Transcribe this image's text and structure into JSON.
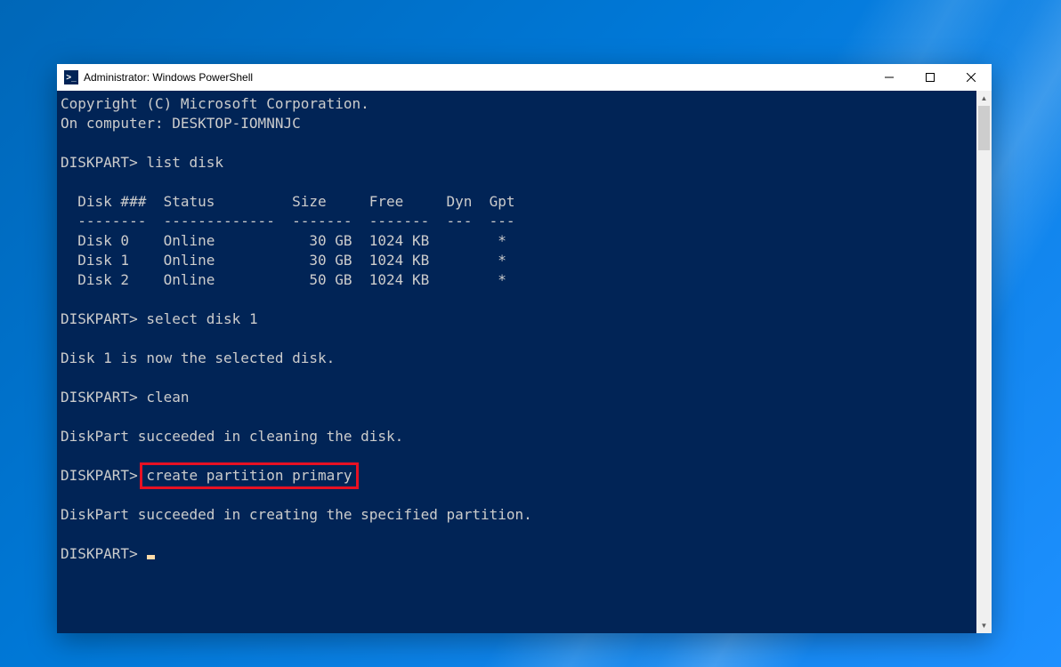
{
  "window": {
    "title": "Administrator: Windows PowerShell",
    "icon_glyph": ">_"
  },
  "terminal": {
    "copyright": "Copyright (C) Microsoft Corporation.",
    "on_computer": "On computer: DESKTOP-IOMNNJC",
    "prompt": "DISKPART>",
    "cmd_list_disk": "list disk",
    "table_header": "  Disk ###  Status         Size     Free     Dyn  Gpt",
    "table_divider": "  --------  -------------  -------  -------  ---  ---",
    "disks": [
      "  Disk 0    Online           30 GB  1024 KB        *",
      "  Disk 1    Online           30 GB  1024 KB        *",
      "  Disk 2    Online           50 GB  1024 KB        *"
    ],
    "cmd_select": "select disk 1",
    "msg_selected": "Disk 1 is now the selected disk.",
    "cmd_clean": "clean",
    "msg_cleaned": "DiskPart succeeded in cleaning the disk.",
    "cmd_create": "create partition primary",
    "msg_created": "DiskPart succeeded in creating the specified partition."
  }
}
